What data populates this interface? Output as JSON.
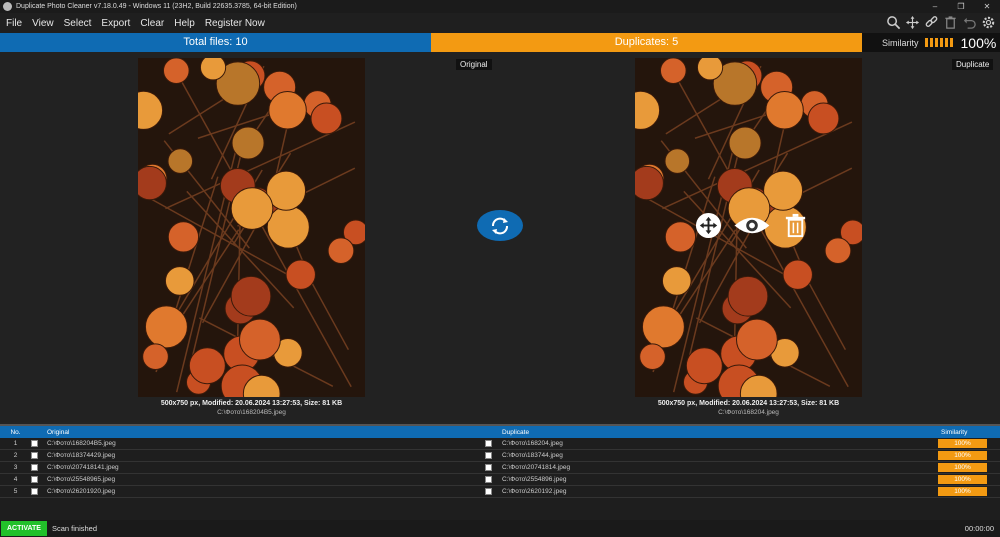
{
  "window": {
    "title": "Duplicate Photo Cleaner v7.18.0.49 - Windows 11 (23H2, Build 22635.3785, 64-bit Edition)",
    "controls": [
      "–",
      "❐",
      "✕"
    ]
  },
  "menu": [
    "File",
    "View",
    "Select",
    "Export",
    "Clear",
    "Help",
    "Register Now"
  ],
  "toolbar_icons": [
    "search-icon",
    "move-icon",
    "link-icon",
    "trash-icon",
    "undo-icon",
    "settings-icon"
  ],
  "stats": {
    "total_label": "Total files: 10",
    "duplicates_label": "Duplicates: 5",
    "similarity_label": "Similarity",
    "similarity_value": "100%",
    "similarity_level": 1.0
  },
  "compare": {
    "original_tag": "Original",
    "duplicate_tag": "Duplicate",
    "original_info": "500x750 px, Modified: 20.06.2024 13:27:53, Size: 81 KB",
    "original_path": "C:\\Фото\\168204B5.jpeg",
    "duplicate_info": "500x750 px, Modified: 20.06.2024 13:27:53, Size: 81 KB",
    "duplicate_path": "C:\\Фото\\168204.jpeg"
  },
  "table": {
    "headers": {
      "no": "No.",
      "original": "Original",
      "duplicate": "Duplicate",
      "similarity": "Similarity"
    },
    "rows": [
      {
        "no": "1",
        "original": "C:\\Фото\\168204B5.jpeg",
        "duplicate": "C:\\Фото\\168204.jpeg",
        "similarity": "100%"
      },
      {
        "no": "2",
        "original": "C:\\Фото\\18374429.jpeg",
        "duplicate": "C:\\Фото\\183744.jpeg",
        "similarity": "100%"
      },
      {
        "no": "3",
        "original": "C:\\Фото\\207418141.jpeg",
        "duplicate": "C:\\Фото\\20741814.jpeg",
        "similarity": "100%"
      },
      {
        "no": "4",
        "original": "C:\\Фото\\25548965.jpeg",
        "duplicate": "C:\\Фото\\2554896.jpeg",
        "similarity": "100%"
      },
      {
        "no": "5",
        "original": "C:\\Фото\\26201920.jpeg",
        "duplicate": "C:\\Фото\\2620192.jpeg",
        "similarity": "100%"
      }
    ]
  },
  "status": {
    "activate_label": "ACTIVATE",
    "message": "Scan finished",
    "timer": "00:00:00"
  },
  "colors": {
    "blue": "#0f6bb3",
    "orange": "#f39a12",
    "green": "#22c02a"
  }
}
